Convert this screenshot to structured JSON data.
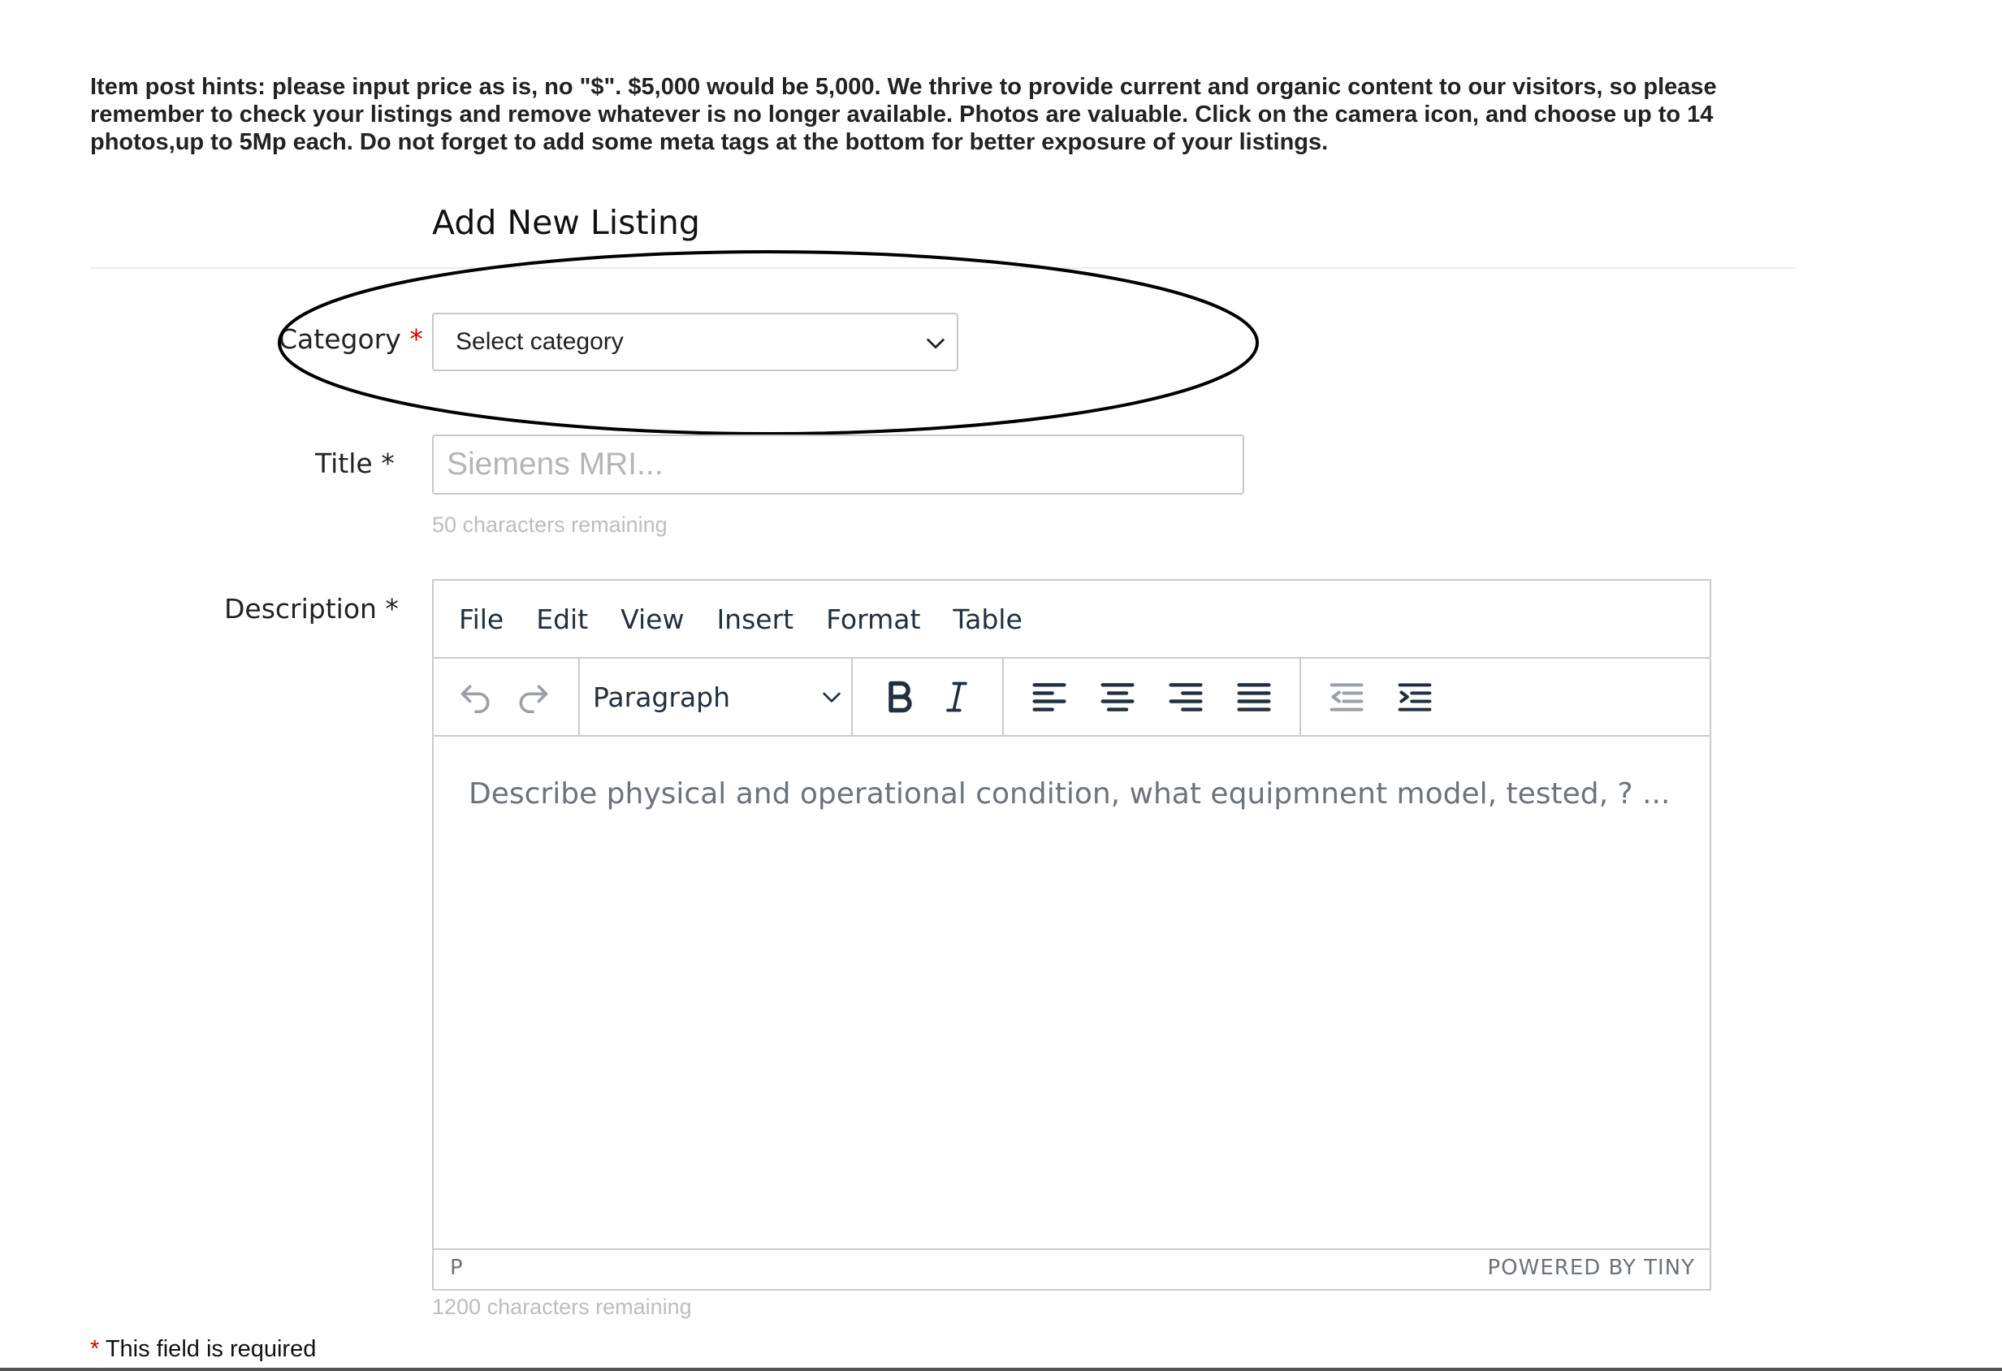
{
  "hints": {
    "text": "Item post hints: please input price as is, no \"$\". $5,000 would be 5,000. We thrive to provide current and organic content to our visitors, so please remember to check your listings and remove whatever is no longer available. Photos are valuable. Click on the camera icon, and choose up to 14 photos,up to 5Mp each. Do not forget to add some meta tags at the bottom for better exposure of your listings."
  },
  "form": {
    "title": "Add New Listing",
    "category": {
      "label": "Category",
      "required_mark": "*",
      "selected": "Select category"
    },
    "title_field": {
      "label": "Title *",
      "placeholder": "Siemens MRI...",
      "remaining": "50 characters remaining"
    },
    "description": {
      "label": "Description *",
      "remaining": "1200 characters remaining"
    }
  },
  "editor": {
    "menu": [
      "File",
      "Edit",
      "View",
      "Insert",
      "Format",
      "Table"
    ],
    "block_format": "Paragraph",
    "placeholder": "Describe physical and operational condition, what equipmnent model, tested, ? ...",
    "status_path": "P",
    "branding": "POWERED BY TINY",
    "icons": [
      "undo-icon",
      "redo-icon",
      "chevron-down-icon",
      "bold-icon",
      "italic-icon",
      "align-left-icon",
      "align-center-icon",
      "align-right-icon",
      "align-justify-icon",
      "outdent-icon",
      "indent-icon"
    ]
  },
  "footer": {
    "required_mark": "*",
    "required_note": "This field is required"
  },
  "colors": {
    "required": "#d00000",
    "toolbar_icon": "#222f3e",
    "border": "#cccccc"
  }
}
